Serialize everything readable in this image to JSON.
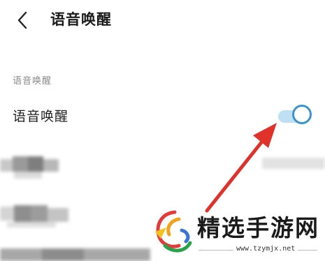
{
  "header": {
    "title": "语音唤醒",
    "back_icon": "chevron-left-icon"
  },
  "section": {
    "label": "语音唤醒"
  },
  "settings": [
    {
      "label": "语音唤醒",
      "toggle_on": true
    }
  ],
  "watermark": {
    "name": "精选手游网",
    "url": "www.tzymjx.net"
  },
  "colors": {
    "accent": "#3a94cf",
    "track": "#bfe0f3",
    "arrow": "#e0312b"
  }
}
